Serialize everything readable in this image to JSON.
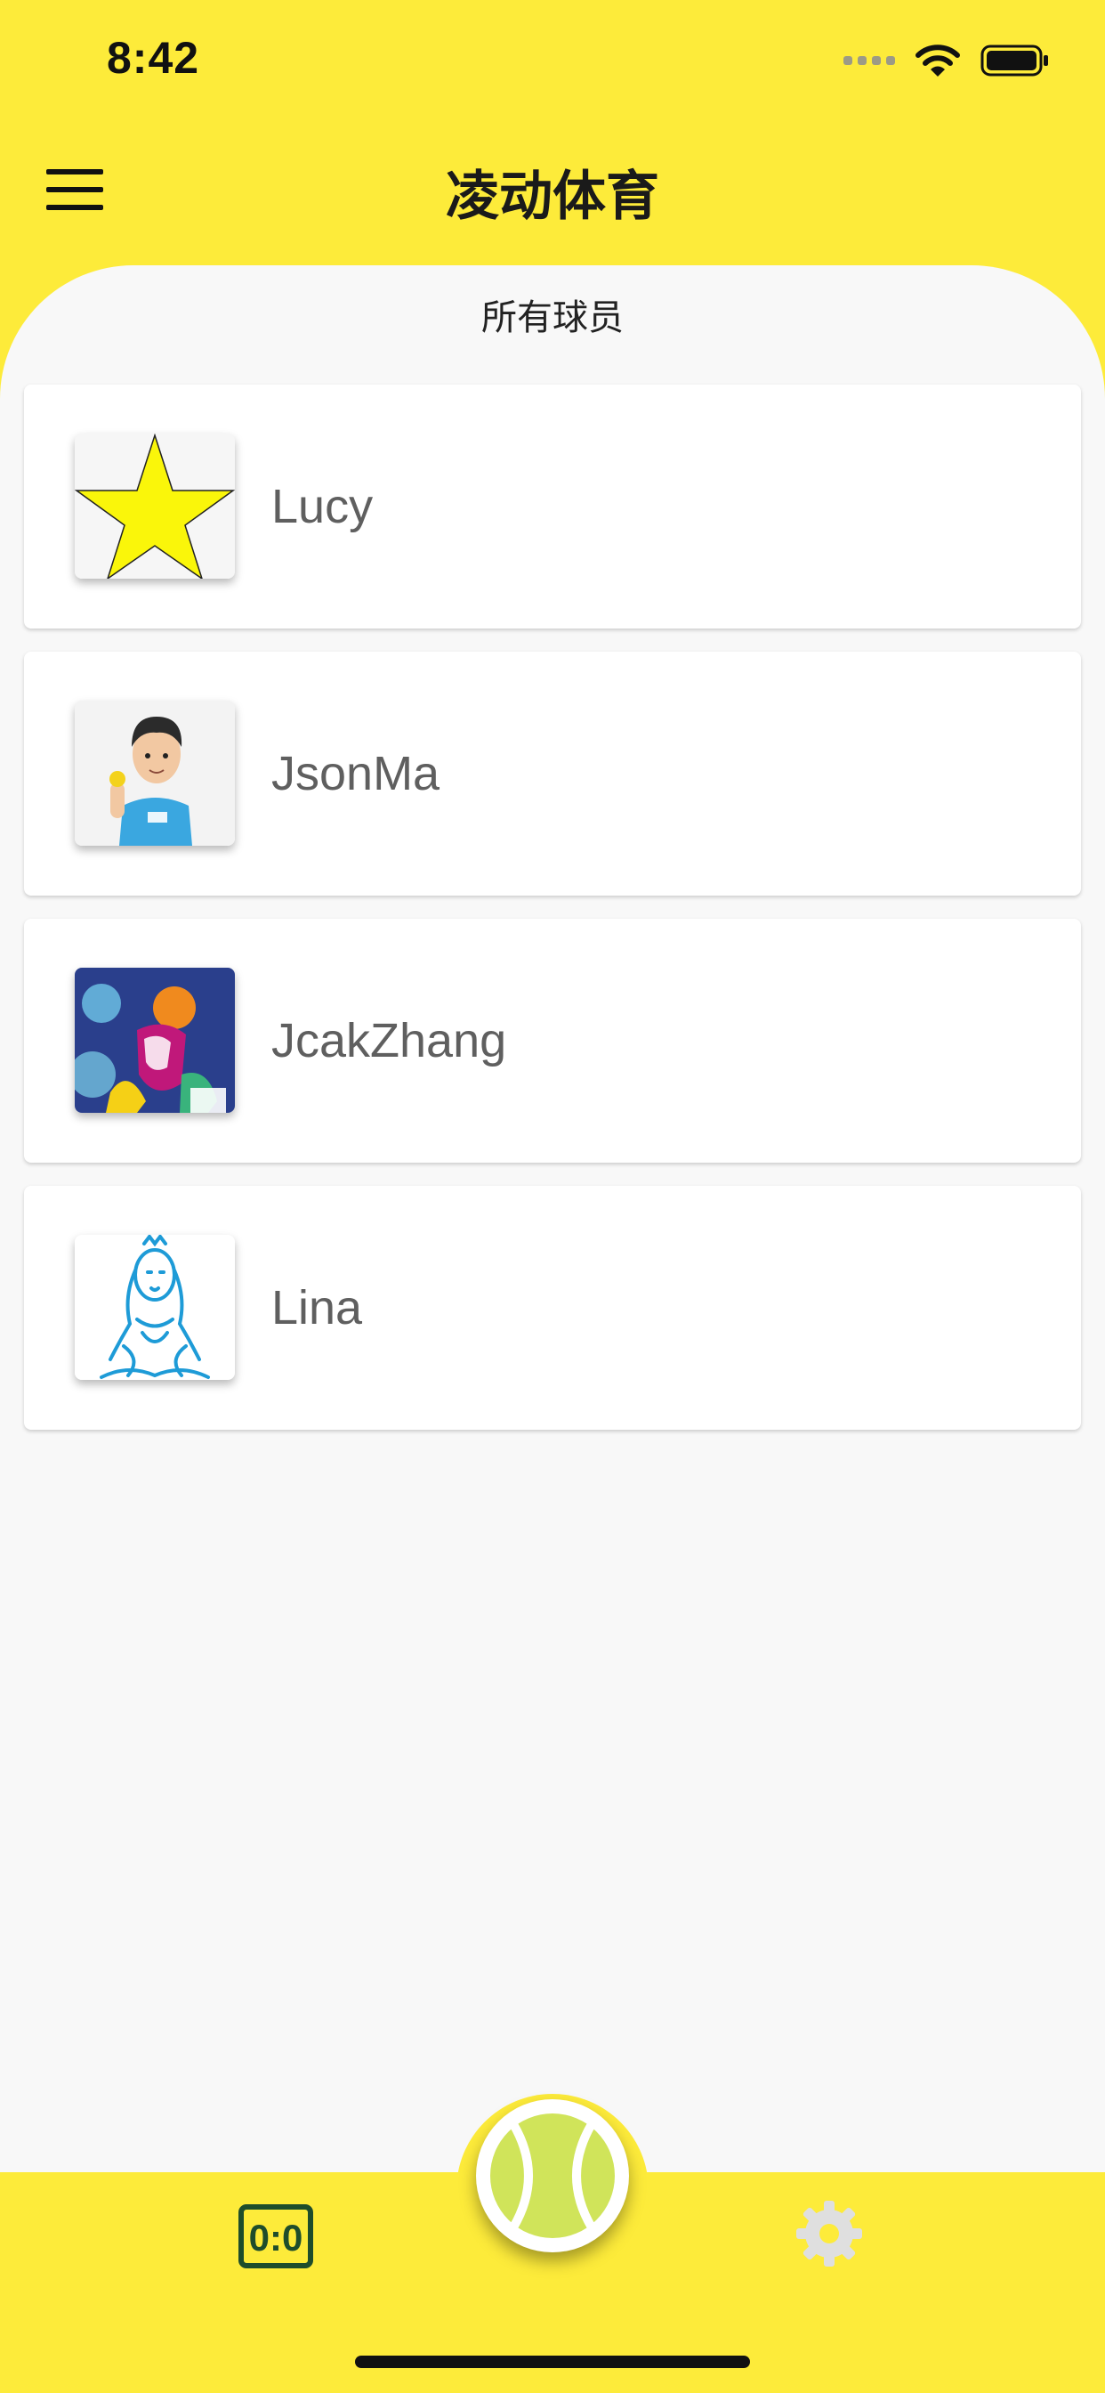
{
  "status_bar": {
    "time": "8:42"
  },
  "header": {
    "title": "凌动体育",
    "menu_icon": "hamburger-menu-icon"
  },
  "section": {
    "title": "所有球员"
  },
  "players": [
    {
      "name": "Lucy",
      "avatar": "star-avatar"
    },
    {
      "name": "JsonMa",
      "avatar": "cartoon-man-avatar"
    },
    {
      "name": "JcakZhang",
      "avatar": "colorful-splash-avatar"
    },
    {
      "name": "Lina",
      "avatar": "blue-line-art-avatar"
    }
  ],
  "bottom_bar": {
    "scoreboard_icon": "scoreboard-icon",
    "scoreboard_text": "0:0",
    "center_icon": "tennis-ball-icon",
    "settings_icon": "gear-icon"
  },
  "colors": {
    "accent_yellow": "#FDEB3A",
    "dark_green": "#1E4D2B",
    "ball_green": "#D0E45A",
    "avatar_blue": "#1E9BD7",
    "text_gray": "#5F5F5F"
  }
}
